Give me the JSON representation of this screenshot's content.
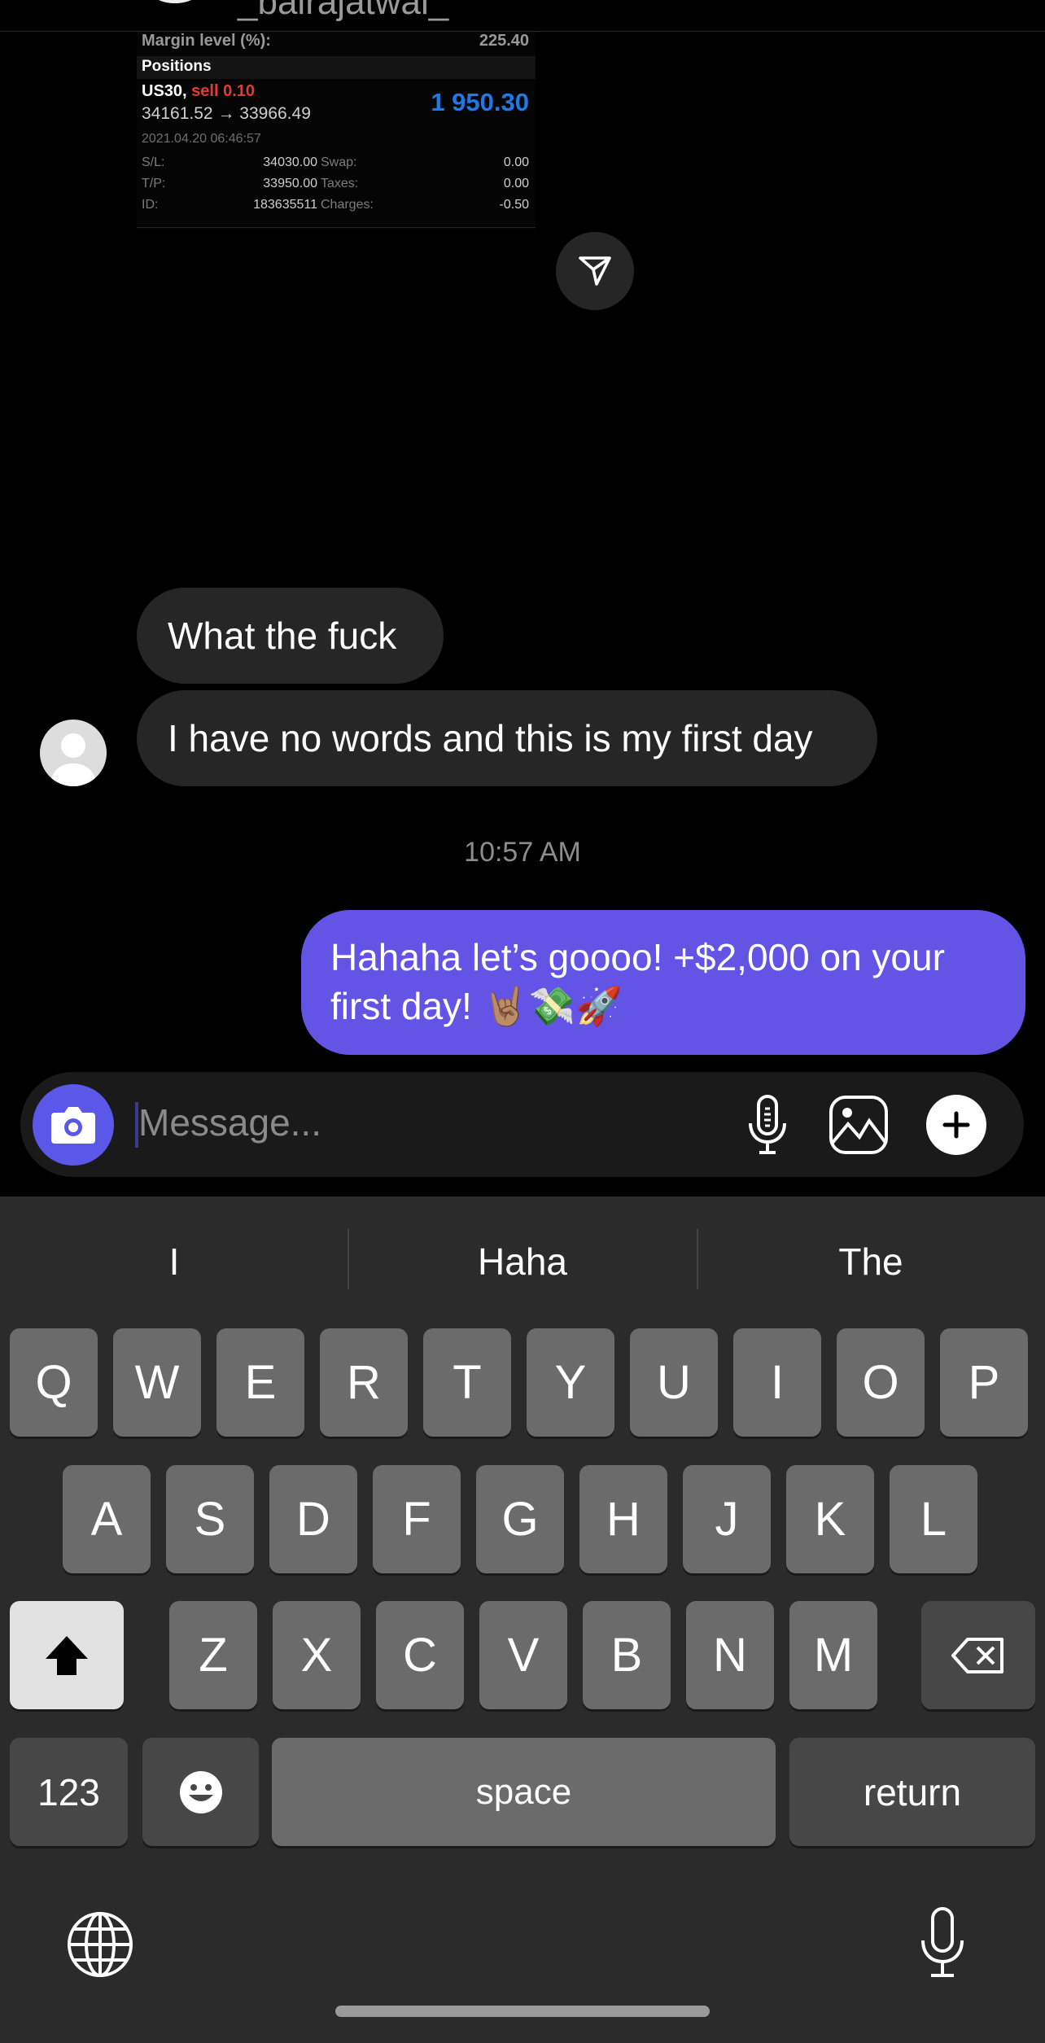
{
  "header": {
    "username": "_bairajatwal_"
  },
  "card": {
    "margin_label": "Margin level (%):",
    "margin_value": "225.40",
    "positions_label": "Positions",
    "symbol": "US30,",
    "side": "sell 0.10",
    "price_open": "34161.52",
    "arrow": "→",
    "price_current": "33966.49",
    "profit": "1 950.30",
    "datetime": "2021.04.20 06:46:57",
    "rows": [
      {
        "l1": "S/L:",
        "v1": "34030.00",
        "l2": "Swap:",
        "v2": "0.00"
      },
      {
        "l1": "T/P:",
        "v1": "33950.00",
        "l2": "Taxes:",
        "v2": "0.00"
      },
      {
        "l1": "ID:",
        "v1": "183635511",
        "l2": "Charges:",
        "v2": "-0.50"
      }
    ],
    "colors": {
      "sell": "#e8392f",
      "profit": "#1f7ae8"
    }
  },
  "messages": {
    "received": [
      "What the fuck",
      "I have no words and this is my first day"
    ],
    "timestamp": "10:57 AM",
    "sent": "Hahaha let’s goooo! +$2,000 on your first day! 🤘🏽💸🚀"
  },
  "composer": {
    "placeholder": "Message...",
    "accent": "#5b57e8"
  },
  "keyboard": {
    "suggestions": [
      "I",
      "Haha",
      "The"
    ],
    "row1": [
      "Q",
      "W",
      "E",
      "R",
      "T",
      "Y",
      "U",
      "I",
      "O",
      "P"
    ],
    "row2": [
      "A",
      "S",
      "D",
      "F",
      "G",
      "H",
      "J",
      "K",
      "L"
    ],
    "row3": [
      "Z",
      "X",
      "C",
      "V",
      "B",
      "N",
      "M"
    ],
    "numbers": "123",
    "space": "space",
    "return": "return"
  }
}
